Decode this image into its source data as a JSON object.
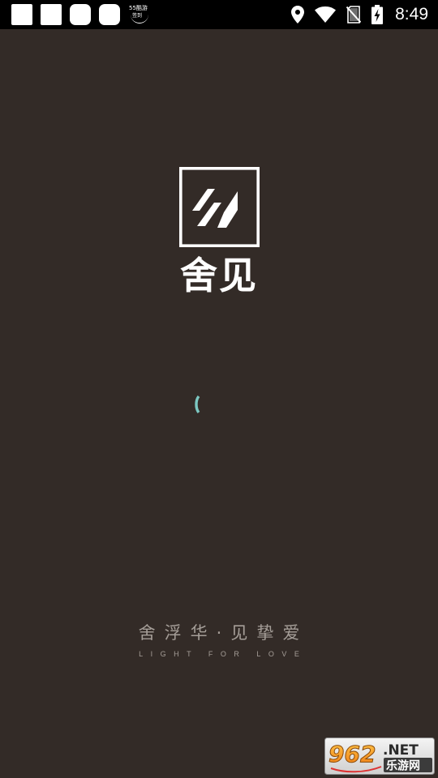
{
  "status_bar": {
    "notification_app_text_top": "55酷游",
    "notification_app_text_bottom": "签到",
    "time": "8:49",
    "icons": [
      "location-icon",
      "wifi-icon",
      "no-sim-icon",
      "battery-charging-icon"
    ]
  },
  "splash": {
    "logo_text": "舍见",
    "slogan_cn": "舍浮华·见挚爱",
    "slogan_en": "LIGHT FOR LOVE",
    "loading_indicator": "spinner"
  },
  "watermark": {
    "number": "962",
    "suffix": ".NET",
    "site_name": "乐游网"
  },
  "colors": {
    "background": "#332b27",
    "status_bar": "#000000",
    "spinner": "#7cc7c1",
    "slogan": "#a59e98",
    "logo": "#ffffff"
  }
}
